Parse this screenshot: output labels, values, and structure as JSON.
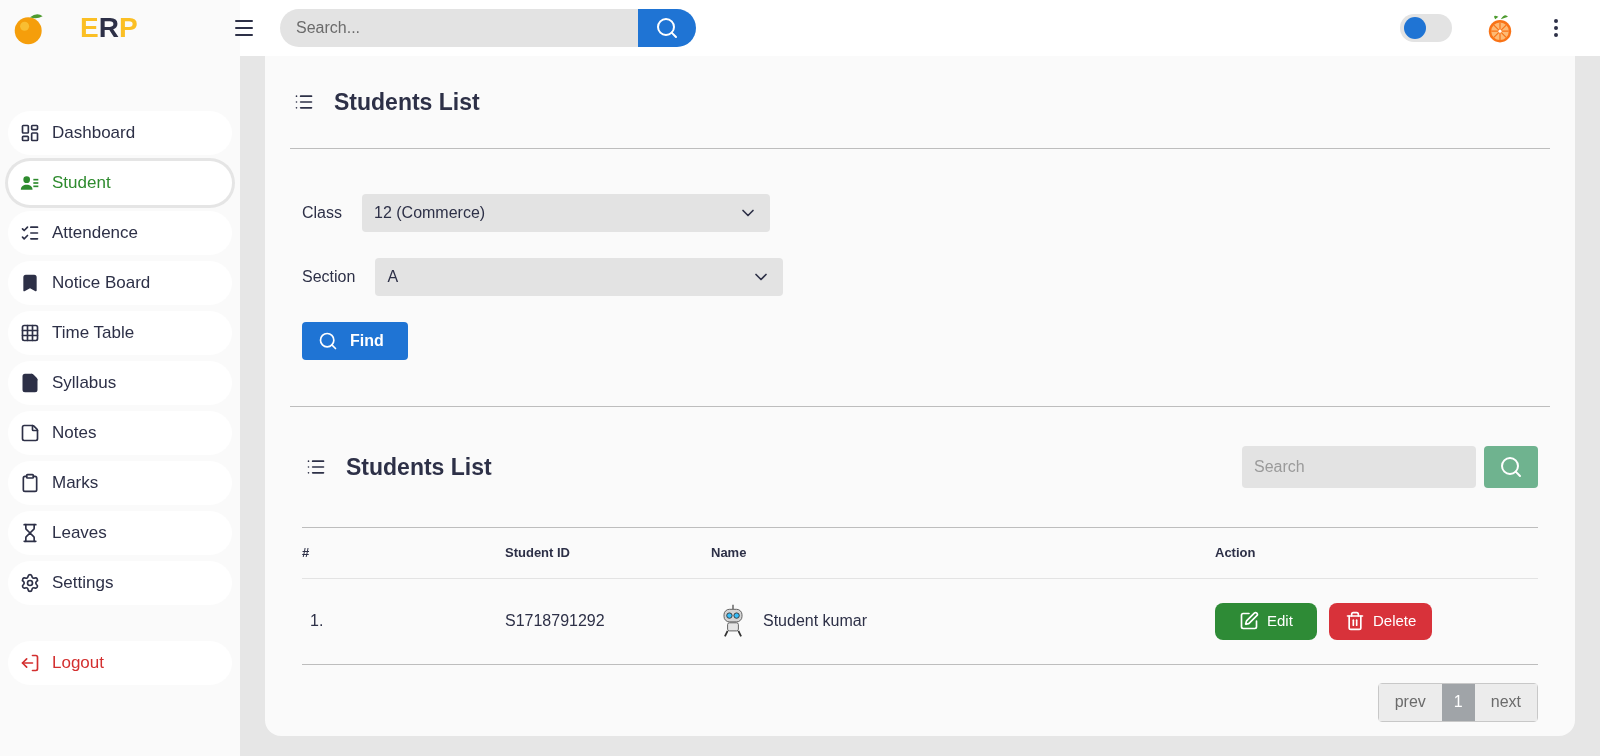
{
  "header": {
    "logo": {
      "letters": [
        {
          "char": "E",
          "color": "#fbbf24"
        },
        {
          "char": "R",
          "color": "#2d3047"
        },
        {
          "char": "P",
          "color": "#fbbf24"
        }
      ]
    },
    "search": {
      "placeholder": "Search..."
    },
    "theme_toggle": {
      "on": false
    }
  },
  "sidebar": {
    "items": [
      {
        "label": "Dashboard",
        "kind": "dashboard",
        "selected": false
      },
      {
        "label": "Student",
        "kind": "student",
        "selected": true
      },
      {
        "label": "Attendence",
        "kind": "attendance",
        "selected": false
      },
      {
        "label": "Notice Board",
        "kind": "notice",
        "selected": false
      },
      {
        "label": "Time Table",
        "kind": "timetable",
        "selected": false
      },
      {
        "label": "Syllabus",
        "kind": "syllabus",
        "selected": false
      },
      {
        "label": "Notes",
        "kind": "notes",
        "selected": false
      },
      {
        "label": "Marks",
        "kind": "marks",
        "selected": false
      },
      {
        "label": "Leaves",
        "kind": "leaves",
        "selected": false
      },
      {
        "label": "Settings",
        "kind": "settings",
        "selected": false
      }
    ],
    "logout": {
      "label": "Logout"
    }
  },
  "filter": {
    "title": "Students List",
    "fields": [
      {
        "label": "Class",
        "value": "12 (Commerce)"
      },
      {
        "label": "Section",
        "value": "A"
      }
    ],
    "find_button": "Find"
  },
  "list": {
    "title": "Students List",
    "search": {
      "placeholder": "Search"
    },
    "table": {
      "columns": [
        "#",
        "Student ID",
        "Name",
        "Action"
      ],
      "rows": [
        {
          "index": "1.",
          "student_id": "S1718791292",
          "name": "Student kumar",
          "edit": "Edit",
          "delete": "Delete"
        }
      ]
    },
    "pagination": {
      "prev": "prev",
      "pages": [
        {
          "label": "1",
          "selected": true
        }
      ],
      "next": "next"
    }
  }
}
